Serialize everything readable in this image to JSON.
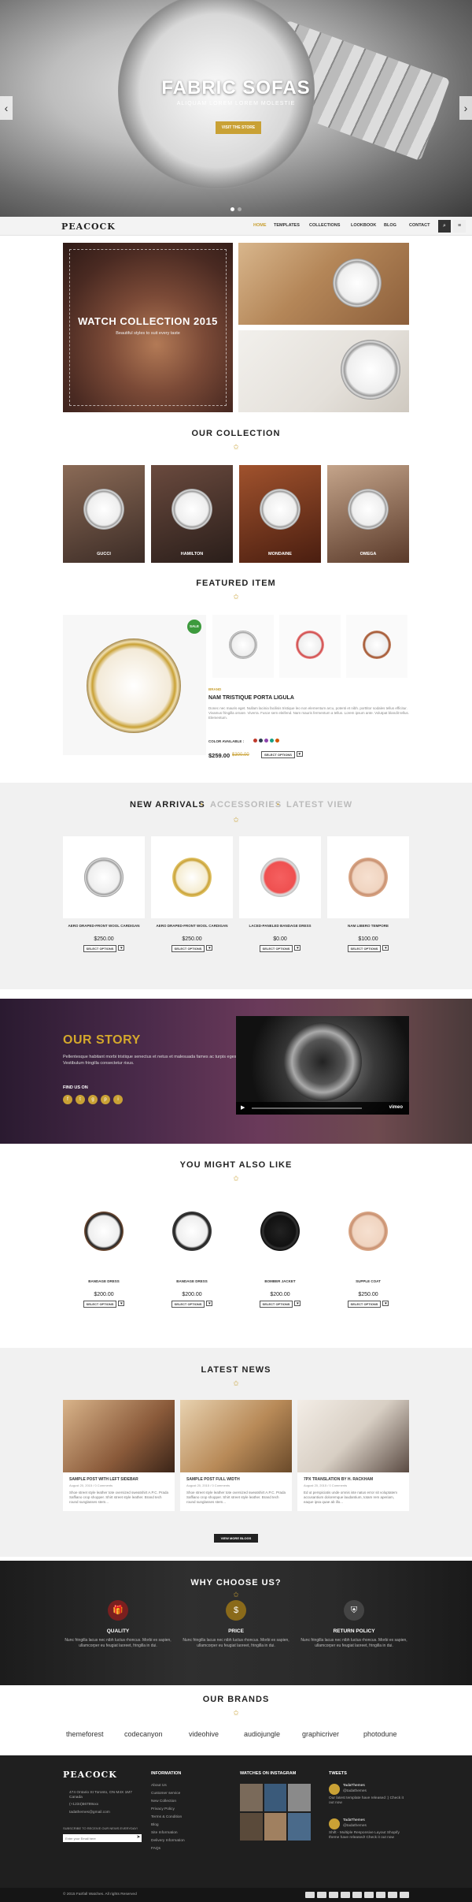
{
  "hero": {
    "title": "FABRIC SOFAS",
    "subtitle": "ALIQUAM LOREM LOREM MOLESTIE",
    "button": "VISIT THE STORE",
    "prev": "‹",
    "next": "›"
  },
  "nav": {
    "logo": "PEACOCK",
    "items": [
      "HOME",
      "TEMPLATES",
      "COLLECTIONS",
      "LOOKBOOK",
      "BLOG",
      "CONTACT"
    ],
    "search_icon": "⌕",
    "menu_icon": "≡"
  },
  "banner": {
    "title": "WATCH COLLECTION 2015",
    "subtitle": "Beautiful styles to suit every taste"
  },
  "collection": {
    "title": "OUR COLLECTION",
    "items": [
      "GUCCI",
      "HAMILTON",
      "MONDAINE",
      "OMEGA"
    ]
  },
  "featured": {
    "title": "FEATURED ITEM",
    "sale": "SALE",
    "brand": "BRAND",
    "name": "NAM TRISTIQUE PORTA LIGULA",
    "description": "Donec nec mauris eget. Nullam lacinia facilisis tristique leo non elementum arcu, potenti et nibh. porttitor sodales tellus efficitur. Vivamus fringilla ornare. Viverra. Fusce sem eleifend. Nam mauris fermentum a tellus. Lorem ipsum ante. Volutpat blandit tellus. Elementum.",
    "color_label": "COLOR AVAILABLE :",
    "colors": [
      "#c0392b",
      "#2c3e50",
      "#8e44ad",
      "#16a085",
      "#d35400"
    ],
    "price": "$259.00",
    "old_price": "$300.00",
    "select": "SELECT OPTIONS",
    "heart": "♥"
  },
  "arrivals": {
    "tabs": [
      "NEW ARRIVALS",
      "ACCESSORIES",
      "LATEST VIEW"
    ],
    "products": [
      {
        "name": "AERO DRAPED-FRONT WOOL CARDIGAN",
        "price": "$250.00"
      },
      {
        "name": "AERO DRAPED-FRONT WOOL CARDIGAN",
        "price": "$250.00"
      },
      {
        "name": "LACED-PANELED BANDAGE DRESS",
        "price": "$0.00"
      },
      {
        "name": "NAM LIBERO TEMPORE",
        "price": "$100.00"
      }
    ],
    "select": "SELECT OPTIONS",
    "heart": "♥"
  },
  "story": {
    "title": "OUR STORY",
    "text": "Pellentesque habitant morbi tristique senectus et netus et malesuada fames ac turpis egestas. Vestibulum fringilla consectetur risus.",
    "find": "FIND US ON",
    "socials": [
      "f",
      "t",
      "g",
      "p",
      "i"
    ],
    "video_brand": "vimeo",
    "play": "▶"
  },
  "alsolike": {
    "title": "YOU MIGHT ALSO LIKE",
    "products": [
      {
        "name": "BANDAGE DRESS",
        "price": "$200.00"
      },
      {
        "name": "BANDAGE DRESS",
        "price": "$200.00"
      },
      {
        "name": "BOMBER JACKET",
        "price": "$200.00"
      },
      {
        "name": "SUPPLE COAT",
        "price": "$250.00"
      }
    ],
    "select": "SELECT OPTIONS",
    "heart": "♥"
  },
  "news": {
    "title": "LATEST NEWS",
    "posts": [
      {
        "title": "SAMPLE POST WITH LEFT SIDEBAR",
        "meta": "August 20, 2015 / 0 Comments",
        "text": "Shoe street style leather tote oversized sweatshirt A.P.C. Prada Saffiano crop shopper. Shirt street style leather. Brand tech round sunglasses stem..."
      },
      {
        "title": "SAMPLE POST FULL WIDTH",
        "meta": "August 20, 2015 / 0 Comments",
        "text": "Shoe street style leather tote oversized sweatshirt A.P.C. Prada Saffiano crop shopper. Shirt street style leather. Brand tech round sunglasses stem..."
      },
      {
        "title": "7PX TRANSLATION BY H. RACKHAM",
        "meta": "August 20, 2015 / 0 Comments",
        "text": "Ed ut perspiciatis unde omnis iste natus error sit voluptatem accusantium doloremque laudantium, totam rem aperiam, eaque ipsa quae ab illo..."
      }
    ],
    "button": "VIEW MORE BLOGS"
  },
  "why": {
    "title": "WHY CHOOSE US?",
    "items": [
      {
        "icon": "🎁",
        "title": "QUALITY",
        "text": "Nunc fringilla lacus nec nibh luctus rhoncus. Morbi ex sapien, ullamcorper eu feugiat laoreet, fringilla in dui."
      },
      {
        "icon": "$",
        "title": "PRICE",
        "text": "Nunc fringilla lacus nec nibh luctus rhoncus. Morbi ex sapien, ullamcorper eu feugiat laoreet, fringilla in dui."
      },
      {
        "icon": "⛨",
        "title": "RETURN POLICY",
        "text": "Nunc fringilla lacus nec nibh luctus rhoncus. Morbi ex sapien, ullamcorper eu feugiat laoreet, fringilla in dui."
      }
    ]
  },
  "brands": {
    "title": "OUR BRANDS",
    "items": [
      "themeforest",
      "codecanyon",
      "videohive",
      "audiojungle",
      "graphicriver",
      "photodune"
    ]
  },
  "footer": {
    "logo": "PEACOCK",
    "address": "474 Ontario St Toronto, ON M4X 1M7 Canada",
    "phone": "(+1234)56789xxx",
    "email": "tadathemes@gmail.com",
    "newsletter": "SUBSCRIBE TO RECEIVE OUR NEWS EVERYDAY!",
    "newsletter_placeholder": "Enter your Email here",
    "info_title": "INFORMATION",
    "info_links": [
      "About Us",
      "Customer service",
      "New Collection",
      "Privacy Policy",
      "Terms & Condition",
      "Blog",
      "Site Information",
      "Delivery Information",
      "FAQs"
    ],
    "insta_title": "WATCHES ON INSTAGRAM",
    "tweets_title": "TWEETS",
    "tweets": [
      {
        "user": "TadaThemes",
        "handle": "@tadathemes",
        "text": "Our latest template have released :) Check it out now"
      },
      {
        "user": "TadaThemes",
        "handle": "@tadathemes",
        "text": "Shift - Multiple Responsive Layout Shopify theme have released! Check it out now"
      }
    ],
    "copyright": "© 2015 Fairfall Watches. All rights Reserved"
  }
}
